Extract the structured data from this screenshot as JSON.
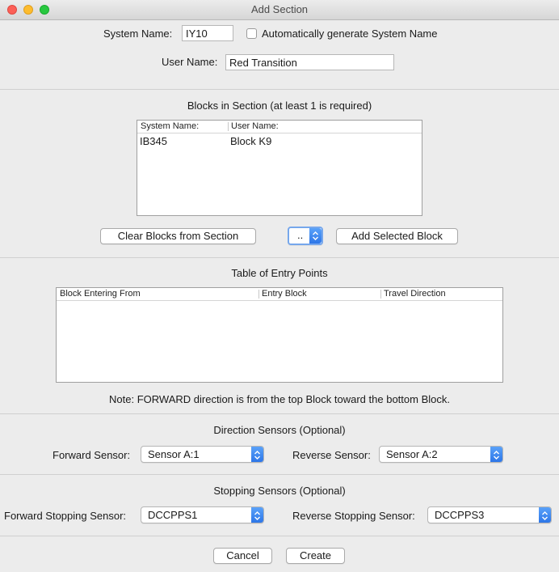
{
  "window": {
    "title": "Add Section"
  },
  "form": {
    "system_name_label": "System Name:",
    "system_name_value": "IY10",
    "auto_generate_label": "Automatically generate System Name",
    "user_name_label": "User Name:",
    "user_name_value": "Red Transition"
  },
  "blocks": {
    "heading": "Blocks in Section (at least 1 is required)",
    "columns": [
      "System Name:",
      "User Name:"
    ],
    "rows": [
      {
        "system_name": "IB345",
        "user_name": "Block K9"
      }
    ],
    "clear_button": "Clear Blocks from Section",
    "selector_value": "..",
    "add_button": "Add Selected Block"
  },
  "entry_points": {
    "heading": "Table of Entry Points",
    "columns": [
      "Block Entering From",
      "Entry Block",
      "Travel Direction"
    ],
    "note": "Note: FORWARD direction is from the top Block toward the bottom Block."
  },
  "direction_sensors": {
    "heading": "Direction Sensors (Optional)",
    "forward_label": "Forward Sensor:",
    "forward_value": "Sensor A:1",
    "reverse_label": "Reverse Sensor:",
    "reverse_value": "Sensor A:2"
  },
  "stopping_sensors": {
    "heading": "Stopping Sensors (Optional)",
    "forward_label": "Forward Stopping Sensor:",
    "forward_value": "DCCPPS1",
    "reverse_label": "Reverse Stopping Sensor:",
    "reverse_value": "DCCPPS3"
  },
  "actions": {
    "cancel": "Cancel",
    "create": "Create"
  },
  "colors": {
    "accent": "#2d76e8",
    "close": "#fc5f57",
    "minimize": "#fdbc2e",
    "maximize": "#28c840"
  }
}
